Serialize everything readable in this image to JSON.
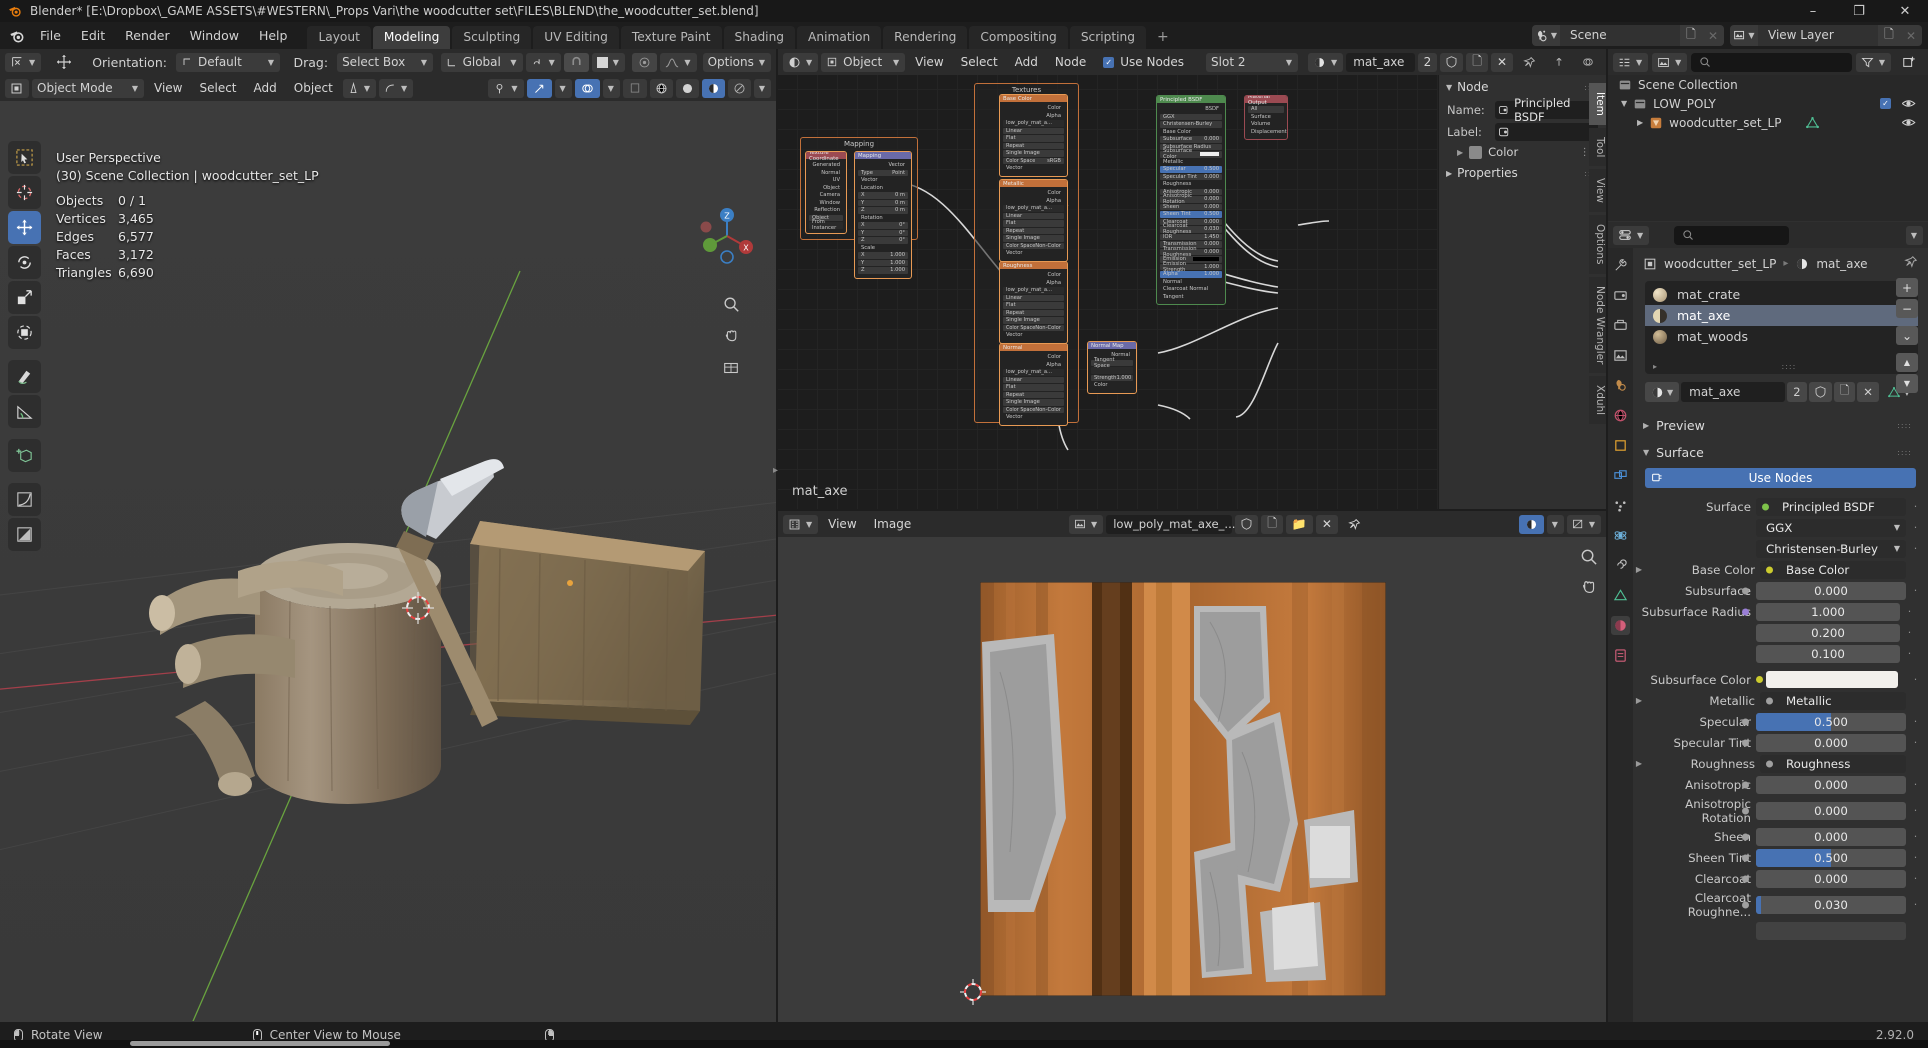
{
  "window": {
    "title": "Blender* [E:\\Dropbox\\_GAME ASSETS\\#WESTERN\\_Props Vari\\the woodcutter set\\FILES\\BLEND\\the_woodcutter_set.blend]",
    "minimize": "–",
    "maximize": "❐",
    "close": "✕"
  },
  "topbar": {
    "menus": [
      "File",
      "Edit",
      "Render",
      "Window",
      "Help"
    ],
    "workspaces": [
      "Layout",
      "Modeling",
      "Sculpting",
      "UV Editing",
      "Texture Paint",
      "Shading",
      "Animation",
      "Rendering",
      "Compositing",
      "Scripting"
    ],
    "active_workspace": "Modeling",
    "add_workspace": "+",
    "scene_name": "Scene",
    "view_layer_name": "View Layer"
  },
  "viewport3d": {
    "tool_header": {
      "orientation_label": "Orientation:",
      "orientation_value": "Default",
      "drag_label": "Drag:",
      "drag_value": "Select Box",
      "transform_value": "Global",
      "options": "Options"
    },
    "header": {
      "mode": "Object Mode",
      "menus": [
        "View",
        "Select",
        "Add",
        "Object"
      ]
    },
    "overlay": {
      "perspective": "User Perspective",
      "collection": "(30) Scene Collection | woodcutter_set_LP",
      "stats": [
        {
          "label": "Objects",
          "value": "0 / 1"
        },
        {
          "label": "Vertices",
          "value": "3,465"
        },
        {
          "label": "Edges",
          "value": "6,577"
        },
        {
          "label": "Faces",
          "value": "3,172"
        },
        {
          "label": "Triangles",
          "value": "6,690"
        }
      ]
    },
    "tools": [
      "tweak-select-tool",
      "cursor-tool",
      "move-tool",
      "rotate-tool",
      "scale-tool",
      "transform-tool",
      "annotate-tool",
      "measure-tool",
      "add-cube-tool",
      "extrude-region-tool",
      "bevel-tool"
    ],
    "active_tool": "move-tool"
  },
  "shader_editor": {
    "header": {
      "shader_type": "Object",
      "menus": [
        "View",
        "Select",
        "Add",
        "Node"
      ],
      "use_nodes_label": "Use Nodes",
      "use_nodes_checked": true,
      "slot": "Slot 2",
      "material": "mat_axe",
      "users": "2"
    },
    "editor_label": "mat_axe",
    "frames": [
      {
        "name": "Mapping",
        "label": "Mapping"
      },
      {
        "name": "Textures",
        "label": "Textures"
      }
    ],
    "nodes": [
      {
        "title": "Texture Coordinate",
        "color": "#9b4a52",
        "outputs": [
          "Generated",
          "Normal",
          "UV",
          "Object",
          "Camera",
          "Window",
          "Reflection"
        ],
        "props": [
          "Object",
          "From Instancer"
        ]
      },
      {
        "title": "Mapping",
        "color": "#6a6aa8",
        "outputs": [
          "Vector"
        ],
        "inputs": [
          "Vector"
        ],
        "props": [
          [
            "Type",
            "Point"
          ],
          [
            "Location",
            ""
          ],
          [
            "X",
            "0 m"
          ],
          [
            "Y",
            "0 m"
          ],
          [
            "Z",
            "0 m"
          ],
          [
            "Rotation",
            ""
          ],
          [
            "X",
            "0°"
          ],
          [
            "Y",
            "0°"
          ],
          [
            "Z",
            "0°"
          ],
          [
            "Scale",
            ""
          ],
          [
            "X",
            "1.000"
          ],
          [
            "Y",
            "1.000"
          ],
          [
            "Z",
            "1.000"
          ]
        ]
      },
      {
        "title": "Base Color",
        "color": "#c2703a",
        "image": "low_poly_mat_a...",
        "outputs": [
          "Color",
          "Alpha"
        ],
        "inputs": [
          "Vector"
        ],
        "props": [
          "Linear",
          "Flat",
          "Repeat",
          "Single Image"
        ],
        "colorspace": "sRGB"
      },
      {
        "title": "Metallic",
        "color": "#c2703a",
        "image": "low_poly_mat_a...",
        "outputs": [
          "Color",
          "Alpha"
        ],
        "inputs": [
          "Vector"
        ],
        "props": [
          "Linear",
          "Flat",
          "Repeat",
          "Single Image"
        ],
        "colorspace": "Non-Color"
      },
      {
        "title": "Roughness",
        "color": "#c2703a",
        "image": "low_poly_mat_a...",
        "outputs": [
          "Color",
          "Alpha"
        ],
        "inputs": [
          "Vector"
        ],
        "props": [
          "Linear",
          "Flat",
          "Repeat",
          "Single Image"
        ],
        "colorspace": "Non-Color"
      },
      {
        "title": "Normal",
        "color": "#c2703a",
        "image": "low_poly_mat_a...",
        "outputs": [
          "Color",
          "Alpha"
        ],
        "inputs": [
          "Vector"
        ],
        "props": [
          "Linear",
          "Flat",
          "Repeat",
          "Single Image"
        ],
        "colorspace": "Non-Color"
      },
      {
        "title": "Normal Map",
        "color": "#6a6aa8",
        "outputs": [
          "Normal"
        ],
        "inputs": [
          "Strength",
          "Color"
        ],
        "props": [
          [
            "Tangent Space",
            ""
          ],
          [
            "Strength",
            "1.000"
          ]
        ]
      },
      {
        "title": "Principled BSDF",
        "color": "#4e8a4e",
        "outputs": [
          "BSDF"
        ],
        "props": [
          [
            "GGX",
            ""
          ],
          [
            "Christensen-Burley",
            ""
          ]
        ],
        "inputs": [
          [
            "Base Color",
            ""
          ],
          [
            "Subsurface",
            "0.000"
          ],
          [
            "Subsurface Radius",
            ""
          ],
          [
            "Subsurface Color",
            "swatch"
          ],
          [
            "Metallic",
            ""
          ],
          [
            "Specular",
            "0.500"
          ],
          [
            "Specular Tint",
            "0.000"
          ],
          [
            "Roughness",
            ""
          ],
          [
            "Anisotropic",
            "0.000"
          ],
          [
            "Anisotropic Rotation",
            "0.000"
          ],
          [
            "Sheen",
            "0.000"
          ],
          [
            "Sheen Tint",
            "0.500"
          ],
          [
            "Clearcoat",
            "0.000"
          ],
          [
            "Clearcoat Roughness",
            "0.030"
          ],
          [
            "IOR",
            "1.450"
          ],
          [
            "Transmission",
            "0.000"
          ],
          [
            "Transmission Roughness",
            "0.000"
          ],
          [
            "Emission",
            "swatch"
          ],
          [
            "Emission Strength",
            "1.000"
          ],
          [
            "Alpha",
            "1.000"
          ],
          [
            "Normal",
            ""
          ],
          [
            "Clearcoat Normal",
            ""
          ],
          [
            "Tangent",
            ""
          ]
        ]
      },
      {
        "title": "Material Output",
        "color": "#9b4a52",
        "props": [
          [
            "All",
            ""
          ]
        ],
        "inputs": [
          "Surface",
          "Volume",
          "Displacement"
        ]
      }
    ],
    "npanel": {
      "tabs": [
        "Item",
        "Tool",
        "View",
        "Options",
        "Node Wrangler",
        "Xduhl"
      ],
      "active_tab": "Item",
      "section_node": "Node",
      "name_label": "Name:",
      "name_value": "Principled BSDF",
      "label_label": "Label:",
      "label_value": "",
      "color_label": "Color",
      "properties_label": "Properties"
    }
  },
  "image_editor": {
    "header": {
      "menus": [
        "View",
        "Image"
      ],
      "image_name": "low_poly_mat_axe_...",
      "users": ""
    }
  },
  "outliner": {
    "display_mode": "view-layer",
    "search_placeholder": "",
    "rows": [
      {
        "label": "Scene Collection",
        "icon": "collection-icon",
        "indent": 0,
        "checkbox": false,
        "eye": false
      },
      {
        "label": "LOW_POLY",
        "icon": "collection-icon",
        "indent": 1,
        "checkbox": true,
        "eye": true,
        "disclosure": "▼"
      },
      {
        "label": "woodcutter_set_LP",
        "icon": "mesh-object-icon",
        "indent": 2,
        "checkbox": false,
        "eye": true,
        "disclosure": "▶"
      }
    ]
  },
  "properties": {
    "search_placeholder": "",
    "breadcrumb": [
      "woodcutter_set_LP",
      "mat_axe"
    ],
    "material_slots": [
      {
        "name": "mat_crate",
        "color": "#cfc0a0",
        "selected": false
      },
      {
        "name": "mat_axe",
        "color": "#d8c8a4",
        "selected": true
      },
      {
        "name": "mat_woods",
        "color": "#b8a382",
        "selected": false
      }
    ],
    "slot_buttons": [
      "+",
      "−",
      "⌄",
      "▲",
      "▼"
    ],
    "material_field": "mat_axe",
    "material_users": "2",
    "sections": {
      "preview": "Preview",
      "surface": "Surface"
    },
    "use_nodes": "Use Nodes",
    "rows": [
      {
        "label": "Surface",
        "type": "link",
        "value": "Principled BSDF",
        "dot": "#7ec24a"
      },
      {
        "label": "",
        "type": "dropdown",
        "value": "GGX"
      },
      {
        "label": "",
        "type": "dropdown",
        "value": "Christensen-Burley"
      },
      {
        "label": "Base Color",
        "type": "link",
        "value": "Base Color",
        "dot": "#cbcb2e",
        "tri": true
      },
      {
        "label": "Subsurface",
        "type": "slider",
        "value": "0.000",
        "fill": 0,
        "dot": "#a0a0a0"
      },
      {
        "label": "Subsurface Radius",
        "type": "slider",
        "value": "1.000",
        "fill": 0,
        "dot": "#9a7fd6"
      },
      {
        "label": "",
        "type": "slider",
        "value": "0.200",
        "fill": 0
      },
      {
        "label": "",
        "type": "slider",
        "value": "0.100",
        "fill": 0
      },
      {
        "label": "Subsurface Color",
        "type": "color",
        "value": "#f2f0ec",
        "dot": "#cbcb2e"
      },
      {
        "label": "Metallic",
        "type": "link",
        "value": "Metallic",
        "dot": "#a0a0a0",
        "tri": true
      },
      {
        "label": "Specular",
        "type": "slider",
        "value": "0.500",
        "fill": 50,
        "dot": "#a0a0a0"
      },
      {
        "label": "Specular Tint",
        "type": "slider",
        "value": "0.000",
        "fill": 0,
        "dot": "#a0a0a0"
      },
      {
        "label": "Roughness",
        "type": "link",
        "value": "Roughness",
        "dot": "#a0a0a0",
        "tri": true
      },
      {
        "label": "Anisotropic",
        "type": "slider",
        "value": "0.000",
        "fill": 0,
        "dot": "#a0a0a0"
      },
      {
        "label": "Anisotropic Rotation",
        "type": "slider",
        "value": "0.000",
        "fill": 0,
        "dot": "#a0a0a0"
      },
      {
        "label": "Sheen",
        "type": "slider",
        "value": "0.000",
        "fill": 0,
        "dot": "#a0a0a0"
      },
      {
        "label": "Sheen Tint",
        "type": "slider",
        "value": "0.500",
        "fill": 50,
        "dot": "#a0a0a0"
      },
      {
        "label": "Clearcoat",
        "type": "slider",
        "value": "0.000",
        "fill": 0,
        "dot": "#a0a0a0"
      },
      {
        "label": "Clearcoat Roughne...",
        "type": "slider",
        "value": "0.030",
        "fill": 3,
        "dot": "#a0a0a0"
      }
    ],
    "tabs": [
      "tool-icon",
      "render-icon",
      "output-icon",
      "view-layer-icon",
      "scene-icon",
      "world-icon",
      "object-icon",
      "modifier-icon",
      "particles-icon",
      "physics-icon",
      "constraint-icon",
      "data-icon",
      "material-icon",
      "texture-icon"
    ],
    "active_tab": "material-icon"
  },
  "statusbar": {
    "items": [
      {
        "icon": "mouse-left-icon",
        "label": "Rotate View"
      },
      {
        "icon": "mouse-middle-icon",
        "label": "Center View to Mouse"
      },
      {
        "icon": "mouse-right-icon",
        "label": ""
      }
    ],
    "version": "2.92.0"
  },
  "colors": {
    "accent_blue": "#4772b3",
    "node_orange": "#c2703a",
    "header_bg": "#2b2b2b",
    "panel_bg": "#303030"
  }
}
